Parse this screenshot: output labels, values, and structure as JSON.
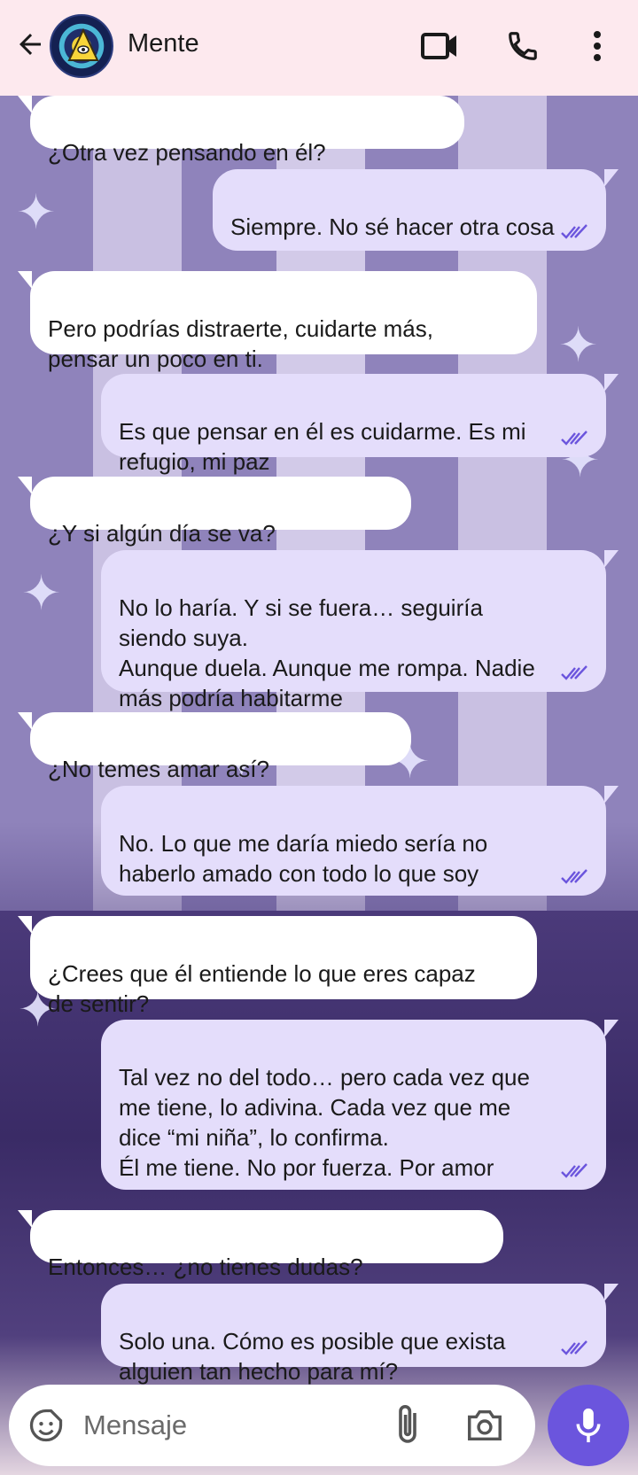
{
  "header": {
    "contact_name": "Mente",
    "icons": [
      "back-arrow-icon",
      "video-call-icon",
      "phone-icon",
      "more-vert-icon"
    ]
  },
  "colors": {
    "header_bg": "#fde9ee",
    "incoming_bubble": "#ffffff",
    "outgoing_bubble": "#e4ddfb",
    "read_ticks": "#6b55dd",
    "mic_button": "#6b55dd"
  },
  "messages": [
    {
      "dir": "in",
      "text": "¿Otra vez pensando en él?"
    },
    {
      "dir": "out",
      "text": "Siempre. No sé hacer otra cosa",
      "status": "read"
    },
    {
      "dir": "in",
      "text": "Pero podrías distraerte, cuidarte más,\npensar un poco en ti."
    },
    {
      "dir": "out",
      "text": "Es que pensar en él es cuidarme. Es mi\nrefugio, mi paz",
      "status": "read"
    },
    {
      "dir": "in",
      "text": "¿Y si algún día se va?"
    },
    {
      "dir": "out",
      "text": "No lo haría. Y si se fuera… seguiría\nsiendo suya.\nAunque duela. Aunque me rompa. Nadie\nmás podría habitarme",
      "status": "read"
    },
    {
      "dir": "in",
      "text": "¿No temes amar así?"
    },
    {
      "dir": "out",
      "text": "No. Lo que me daría miedo sería no\nhaberlo amado con todo lo que soy",
      "status": "read"
    },
    {
      "dir": "in",
      "text": "¿Crees que él entiende lo que eres capaz\nde sentir?"
    },
    {
      "dir": "out",
      "text": "Tal vez no del todo… pero cada vez que\nme tiene, lo adivina. Cada vez que me\ndice “mi niña”, lo confirma.\nÉl me tiene. No por fuerza. Por amor",
      "status": "read"
    },
    {
      "dir": "in",
      "text": "Entonces… ¿no tienes dudas?"
    },
    {
      "dir": "out",
      "text": "Solo una. Cómo es posible que exista\nalguien tan hecho para mí?",
      "status": "read"
    }
  ],
  "composer": {
    "placeholder": "Mensaje",
    "icons": [
      "emoji-icon",
      "attach-icon",
      "camera-icon",
      "mic-icon"
    ]
  }
}
